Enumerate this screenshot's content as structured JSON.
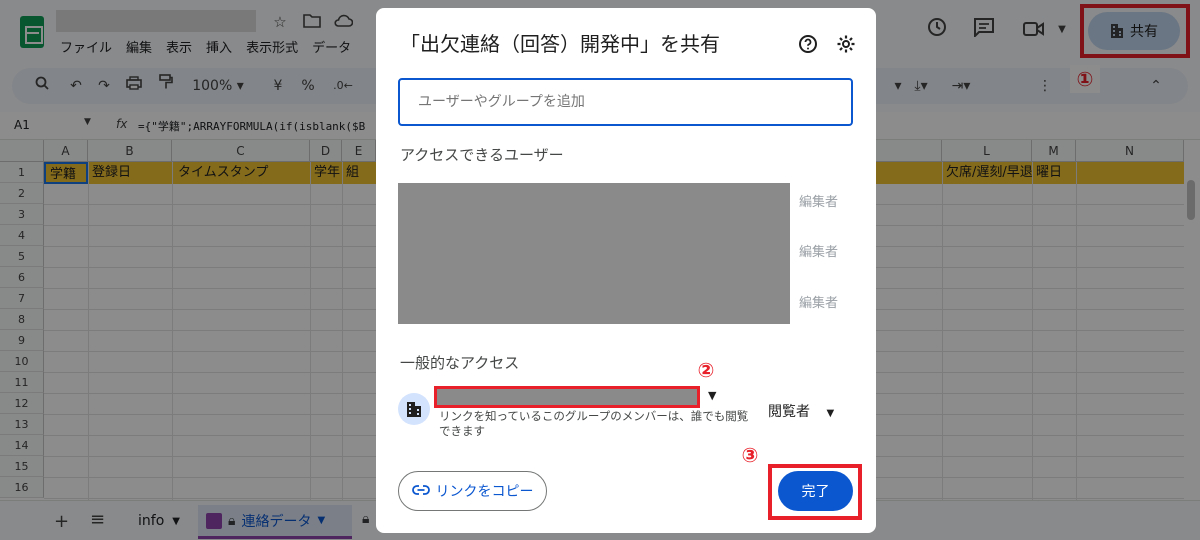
{
  "app": {
    "menu": [
      "ファイル",
      "編集",
      "表示",
      "挿入",
      "表示形式",
      "データ"
    ],
    "share_label": "共有"
  },
  "toolbar": {
    "zoom": "100%",
    "currency": "¥",
    "percent": "%",
    "decimal_dec": ".0←"
  },
  "formula_bar": {
    "cell_ref": "A1",
    "fx": "fx",
    "formula": "={\"学籍\";ARRAYFORMULA(if(isblank($B"
  },
  "grid": {
    "columns": [
      "A",
      "B",
      "C",
      "D",
      "E",
      "L",
      "M",
      "N"
    ],
    "row_numbers": [
      "1",
      "2",
      "3",
      "4",
      "5",
      "6",
      "7",
      "8",
      "9",
      "10",
      "11",
      "12",
      "13",
      "14",
      "15",
      "16"
    ],
    "header_cells": [
      "学籍",
      "登録日",
      "タイムスタンプ",
      "学年",
      "組",
      "欠席/遅刻/早退",
      "曜日"
    ]
  },
  "sheet_tabs": {
    "info": "info",
    "active": "連絡データ"
  },
  "dialog": {
    "title": "「出欠連絡（回答）開発中」を共有",
    "add_placeholder": "ユーザーやグループを追加",
    "access_users_label": "アクセスできるユーザー",
    "roles": [
      "編集者",
      "編集者",
      "編集者"
    ],
    "general_access_label": "一般的なアクセス",
    "general_access_desc": "リンクを知っているこのグループのメンバーは、誰でも閲覧できます",
    "viewer_role": "閲覧者",
    "copy_link": "リンクをコピー",
    "done": "完了"
  },
  "annotations": {
    "one": "①",
    "two": "②",
    "three": "③"
  },
  "colors": {
    "highlight": "#e8202a",
    "primary": "#0b57d0",
    "header_fill": "#f1c232"
  }
}
